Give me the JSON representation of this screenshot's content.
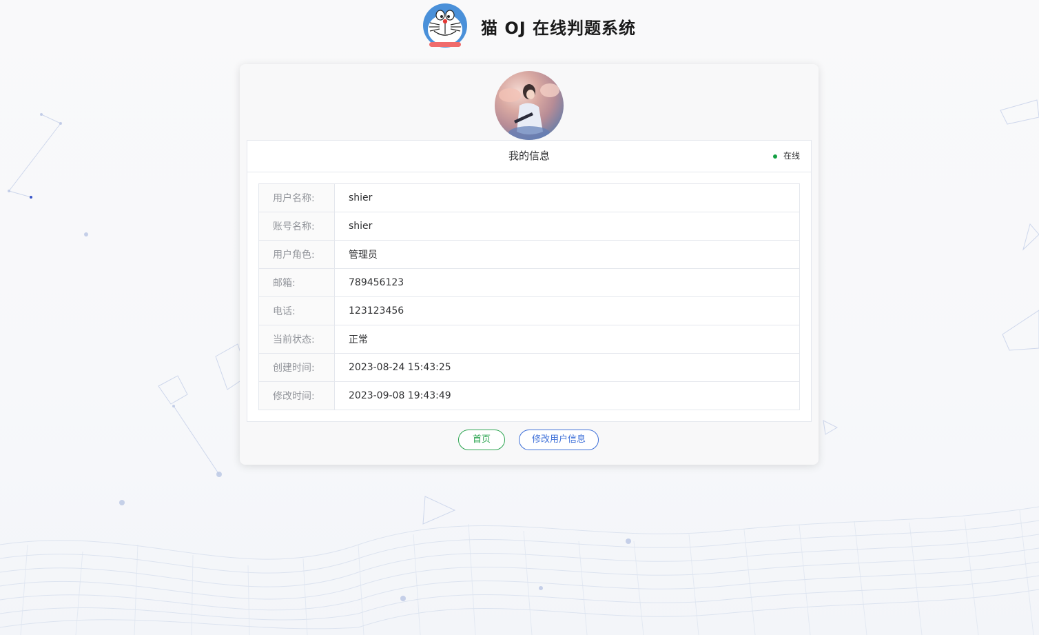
{
  "header": {
    "title": "猫 OJ 在线判题系统"
  },
  "profile": {
    "section_title": "我的信息",
    "status": {
      "label": "在线",
      "color": "#13a043"
    },
    "rows": [
      {
        "label": "用户名称:",
        "value": "shier"
      },
      {
        "label": "账号名称:",
        "value": "shier"
      },
      {
        "label": "用户角色:",
        "value": "管理员"
      },
      {
        "label": "邮箱:",
        "value": "789456123"
      },
      {
        "label": "电话:",
        "value": "123123456"
      },
      {
        "label": "当前状态:",
        "value": "正常"
      },
      {
        "label": "创建时间:",
        "value": "2023-08-24 15:43:25"
      },
      {
        "label": "修改时间:",
        "value": "2023-09-08 19:43:49"
      }
    ]
  },
  "actions": {
    "home_label": "首页",
    "edit_label": "修改用户信息",
    "home_color": "#2aa44f",
    "edit_color": "#3d6fd8"
  },
  "icons": {
    "logo": "doraemon-cat-logo-icon",
    "avatar": "user-avatar-photo"
  }
}
